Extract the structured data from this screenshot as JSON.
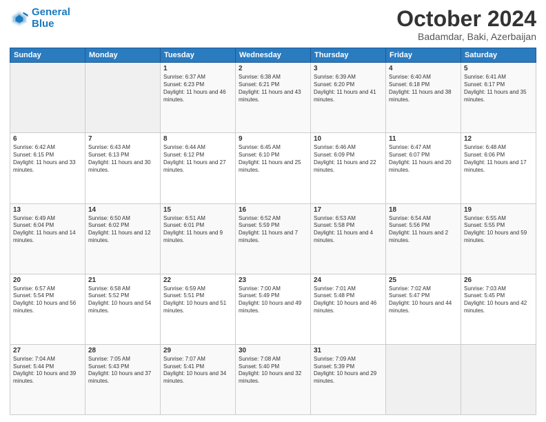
{
  "logo": {
    "line1": "General",
    "line2": "Blue"
  },
  "title": "October 2024",
  "location": "Badamdar, Baki, Azerbaijan",
  "headers": [
    "Sunday",
    "Monday",
    "Tuesday",
    "Wednesday",
    "Thursday",
    "Friday",
    "Saturday"
  ],
  "weeks": [
    [
      {
        "day": "",
        "sunrise": "",
        "sunset": "",
        "daylight": ""
      },
      {
        "day": "",
        "sunrise": "",
        "sunset": "",
        "daylight": ""
      },
      {
        "day": "1",
        "sunrise": "Sunrise: 6:37 AM",
        "sunset": "Sunset: 6:23 PM",
        "daylight": "Daylight: 11 hours and 46 minutes."
      },
      {
        "day": "2",
        "sunrise": "Sunrise: 6:38 AM",
        "sunset": "Sunset: 6:21 PM",
        "daylight": "Daylight: 11 hours and 43 minutes."
      },
      {
        "day": "3",
        "sunrise": "Sunrise: 6:39 AM",
        "sunset": "Sunset: 6:20 PM",
        "daylight": "Daylight: 11 hours and 41 minutes."
      },
      {
        "day": "4",
        "sunrise": "Sunrise: 6:40 AM",
        "sunset": "Sunset: 6:18 PM",
        "daylight": "Daylight: 11 hours and 38 minutes."
      },
      {
        "day": "5",
        "sunrise": "Sunrise: 6:41 AM",
        "sunset": "Sunset: 6:17 PM",
        "daylight": "Daylight: 11 hours and 35 minutes."
      }
    ],
    [
      {
        "day": "6",
        "sunrise": "Sunrise: 6:42 AM",
        "sunset": "Sunset: 6:15 PM",
        "daylight": "Daylight: 11 hours and 33 minutes."
      },
      {
        "day": "7",
        "sunrise": "Sunrise: 6:43 AM",
        "sunset": "Sunset: 6:13 PM",
        "daylight": "Daylight: 11 hours and 30 minutes."
      },
      {
        "day": "8",
        "sunrise": "Sunrise: 6:44 AM",
        "sunset": "Sunset: 6:12 PM",
        "daylight": "Daylight: 11 hours and 27 minutes."
      },
      {
        "day": "9",
        "sunrise": "Sunrise: 6:45 AM",
        "sunset": "Sunset: 6:10 PM",
        "daylight": "Daylight: 11 hours and 25 minutes."
      },
      {
        "day": "10",
        "sunrise": "Sunrise: 6:46 AM",
        "sunset": "Sunset: 6:09 PM",
        "daylight": "Daylight: 11 hours and 22 minutes."
      },
      {
        "day": "11",
        "sunrise": "Sunrise: 6:47 AM",
        "sunset": "Sunset: 6:07 PM",
        "daylight": "Daylight: 11 hours and 20 minutes."
      },
      {
        "day": "12",
        "sunrise": "Sunrise: 6:48 AM",
        "sunset": "Sunset: 6:06 PM",
        "daylight": "Daylight: 11 hours and 17 minutes."
      }
    ],
    [
      {
        "day": "13",
        "sunrise": "Sunrise: 6:49 AM",
        "sunset": "Sunset: 6:04 PM",
        "daylight": "Daylight: 11 hours and 14 minutes."
      },
      {
        "day": "14",
        "sunrise": "Sunrise: 6:50 AM",
        "sunset": "Sunset: 6:02 PM",
        "daylight": "Daylight: 11 hours and 12 minutes."
      },
      {
        "day": "15",
        "sunrise": "Sunrise: 6:51 AM",
        "sunset": "Sunset: 6:01 PM",
        "daylight": "Daylight: 11 hours and 9 minutes."
      },
      {
        "day": "16",
        "sunrise": "Sunrise: 6:52 AM",
        "sunset": "Sunset: 5:59 PM",
        "daylight": "Daylight: 11 hours and 7 minutes."
      },
      {
        "day": "17",
        "sunrise": "Sunrise: 6:53 AM",
        "sunset": "Sunset: 5:58 PM",
        "daylight": "Daylight: 11 hours and 4 minutes."
      },
      {
        "day": "18",
        "sunrise": "Sunrise: 6:54 AM",
        "sunset": "Sunset: 5:56 PM",
        "daylight": "Daylight: 11 hours and 2 minutes."
      },
      {
        "day": "19",
        "sunrise": "Sunrise: 6:55 AM",
        "sunset": "Sunset: 5:55 PM",
        "daylight": "Daylight: 10 hours and 59 minutes."
      }
    ],
    [
      {
        "day": "20",
        "sunrise": "Sunrise: 6:57 AM",
        "sunset": "Sunset: 5:54 PM",
        "daylight": "Daylight: 10 hours and 56 minutes."
      },
      {
        "day": "21",
        "sunrise": "Sunrise: 6:58 AM",
        "sunset": "Sunset: 5:52 PM",
        "daylight": "Daylight: 10 hours and 54 minutes."
      },
      {
        "day": "22",
        "sunrise": "Sunrise: 6:59 AM",
        "sunset": "Sunset: 5:51 PM",
        "daylight": "Daylight: 10 hours and 51 minutes."
      },
      {
        "day": "23",
        "sunrise": "Sunrise: 7:00 AM",
        "sunset": "Sunset: 5:49 PM",
        "daylight": "Daylight: 10 hours and 49 minutes."
      },
      {
        "day": "24",
        "sunrise": "Sunrise: 7:01 AM",
        "sunset": "Sunset: 5:48 PM",
        "daylight": "Daylight: 10 hours and 46 minutes."
      },
      {
        "day": "25",
        "sunrise": "Sunrise: 7:02 AM",
        "sunset": "Sunset: 5:47 PM",
        "daylight": "Daylight: 10 hours and 44 minutes."
      },
      {
        "day": "26",
        "sunrise": "Sunrise: 7:03 AM",
        "sunset": "Sunset: 5:45 PM",
        "daylight": "Daylight: 10 hours and 42 minutes."
      }
    ],
    [
      {
        "day": "27",
        "sunrise": "Sunrise: 7:04 AM",
        "sunset": "Sunset: 5:44 PM",
        "daylight": "Daylight: 10 hours and 39 minutes."
      },
      {
        "day": "28",
        "sunrise": "Sunrise: 7:05 AM",
        "sunset": "Sunset: 5:43 PM",
        "daylight": "Daylight: 10 hours and 37 minutes."
      },
      {
        "day": "29",
        "sunrise": "Sunrise: 7:07 AM",
        "sunset": "Sunset: 5:41 PM",
        "daylight": "Daylight: 10 hours and 34 minutes."
      },
      {
        "day": "30",
        "sunrise": "Sunrise: 7:08 AM",
        "sunset": "Sunset: 5:40 PM",
        "daylight": "Daylight: 10 hours and 32 minutes."
      },
      {
        "day": "31",
        "sunrise": "Sunrise: 7:09 AM",
        "sunset": "Sunset: 5:39 PM",
        "daylight": "Daylight: 10 hours and 29 minutes."
      },
      {
        "day": "",
        "sunrise": "",
        "sunset": "",
        "daylight": ""
      },
      {
        "day": "",
        "sunrise": "",
        "sunset": "",
        "daylight": ""
      }
    ]
  ]
}
